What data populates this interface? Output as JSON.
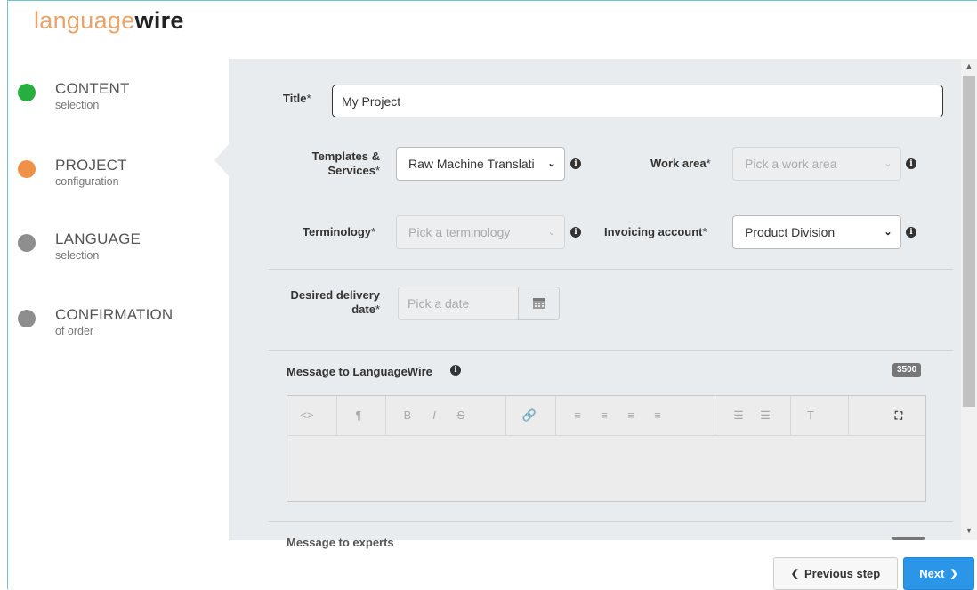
{
  "brand": {
    "logo_light": "language",
    "logo_bold": "wire"
  },
  "steps": [
    {
      "title": "CONTENT",
      "subtitle": "selection",
      "status": "complete",
      "color": "#27ae3f"
    },
    {
      "title": "PROJECT",
      "subtitle": "configuration",
      "status": "current",
      "color": "#f0914a"
    },
    {
      "title": "LANGUAGE",
      "subtitle": "selection",
      "status": "pending",
      "color": "#8e8e8e"
    },
    {
      "title": "CONFIRMATION",
      "subtitle": "of order",
      "status": "pending",
      "color": "#8e8e8e"
    }
  ],
  "form": {
    "title": {
      "label": "Title",
      "required": "*",
      "value": "My Project"
    },
    "templates": {
      "label_line1": "Templates &",
      "label_line2": "Services",
      "required": "*",
      "value": "Raw Machine Translati"
    },
    "work_area": {
      "label": "Work area",
      "required": "*",
      "placeholder": "Pick a work area"
    },
    "terminology": {
      "label": "Terminology",
      "required": "*",
      "placeholder": "Pick a terminology"
    },
    "invoicing": {
      "label": "Invoicing account",
      "required": "*",
      "value": "Product Division"
    },
    "delivery": {
      "label_line1": "Desired delivery",
      "label_line2": "date",
      "required": "*",
      "placeholder": "Pick a date"
    },
    "message_lw": {
      "label": "Message to LanguageWire",
      "char_count": "3500"
    },
    "message_experts": {
      "label": "Message to experts"
    }
  },
  "editor_toolbar": {
    "source": "<>",
    "paragraph": "¶",
    "bold": "B",
    "italic": "I",
    "strike": "S",
    "link": "🔗",
    "align_left": "≡",
    "align_center": "≡",
    "align_right": "≡",
    "justify": "≡",
    "bullets": "☰",
    "numbered": "☰",
    "clear_format": "T",
    "fullscreen": "⛶"
  },
  "info_glyph": "i",
  "caret_glyph": "⌄",
  "footer": {
    "prev_label": "Previous step",
    "next_label": "Next",
    "prev_arrow": "❮",
    "next_arrow": "❯"
  }
}
